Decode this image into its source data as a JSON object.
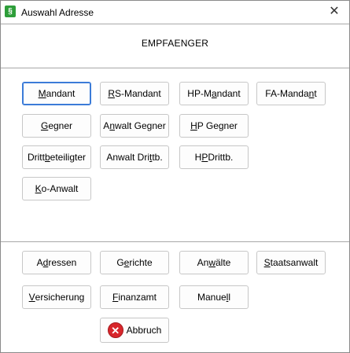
{
  "window": {
    "title": "Auswahl Adresse",
    "app_icon_glyph": "§",
    "close_glyph": "✕"
  },
  "heading": "EMPFAENGER",
  "recipient_buttons": [
    {
      "pre": "",
      "u": "M",
      "post": "andant"
    },
    {
      "pre": "",
      "u": "R",
      "post": "S-Mandant"
    },
    {
      "pre": "HP-M",
      "u": "a",
      "post": "ndant"
    },
    {
      "pre": "FA-Manda",
      "u": "n",
      "post": "t"
    },
    {
      "pre": "",
      "u": "G",
      "post": "egner"
    },
    {
      "pre": "A",
      "u": "n",
      "post": "walt Gegner"
    },
    {
      "pre": "",
      "u": "H",
      "post": "P Gegner"
    },
    {
      "pre": "Dritt",
      "u": "b",
      "post": "eteiligter"
    },
    {
      "pre": "Anwalt Dri",
      "u": "t",
      "post": "tb."
    },
    {
      "pre": "H",
      "u": "P",
      "post": " Drittb."
    },
    {
      "pre": "",
      "u": "K",
      "post": "o-Anwalt"
    }
  ],
  "directory_buttons": [
    {
      "pre": "A",
      "u": "d",
      "post": "ressen"
    },
    {
      "pre": "G",
      "u": "e",
      "post": "richte"
    },
    {
      "pre": "An",
      "u": "w",
      "post": "älte"
    },
    {
      "pre": "",
      "u": "S",
      "post": "taatsanwalt"
    },
    {
      "pre": "",
      "u": "V",
      "post": "ersicherung"
    },
    {
      "pre": "",
      "u": "F",
      "post": "inanzamt"
    },
    {
      "pre": "Manue",
      "u": "l",
      "post": "l"
    }
  ],
  "cancel": {
    "label": "Abbruch",
    "icon_glyph": "✕"
  },
  "colors": {
    "focus": "#3b7bd8",
    "cancel_icon": "#d8262b",
    "app_icon": "#2e9e3a"
  }
}
